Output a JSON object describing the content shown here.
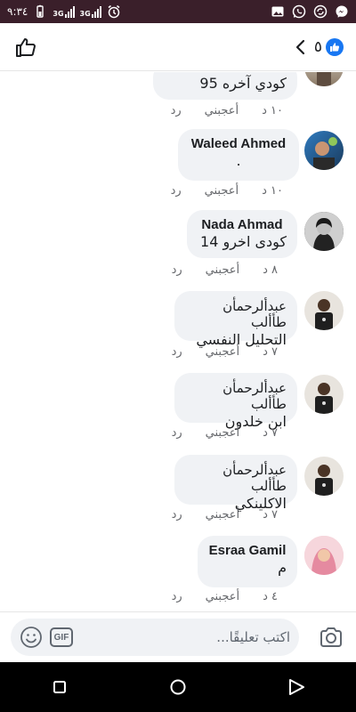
{
  "status_bar": {
    "time": "٩:٣٤",
    "signal_1": "3G",
    "signal_2": "3G"
  },
  "header": {
    "reaction_count": "٥"
  },
  "comments": [
    {
      "name": "",
      "text": "كودي آخره 95",
      "time": "١٠ د",
      "like": "أعجبني",
      "reply": "رد"
    },
    {
      "name": "Waleed Ahmed",
      "text": ".",
      "time": "١٠ د",
      "like": "أعجبني",
      "reply": "رد"
    },
    {
      "name": "Nada Ahmad",
      "text": "كودى اخرو 14",
      "time": "٨ د",
      "like": "أعجبني",
      "reply": "رد"
    },
    {
      "name": "عبدألرحمأن طأألب",
      "text": "التحليل النفسي",
      "time": "٧ د",
      "like": "أعجبني",
      "reply": "رد"
    },
    {
      "name": "عبدألرحمأن طأألب",
      "text": "ابن خلدون",
      "time": "٧ د",
      "like": "أعجبني",
      "reply": "رد"
    },
    {
      "name": "عبدألرحمأن طأألب",
      "text": "الاكلينكي",
      "time": "٧ د",
      "like": "أعجبني",
      "reply": "رد"
    },
    {
      "name": "Esraa Gamil",
      "text": "م",
      "time": "٤ د",
      "like": "أعجبني",
      "reply": "رد"
    }
  ],
  "composer": {
    "placeholder": "اكتب تعليقًا...",
    "gif_label": "GIF"
  },
  "colors": {
    "accent": "#1877f2",
    "bubble": "#f0f2f5",
    "status_bar": "#3a1f2a"
  }
}
